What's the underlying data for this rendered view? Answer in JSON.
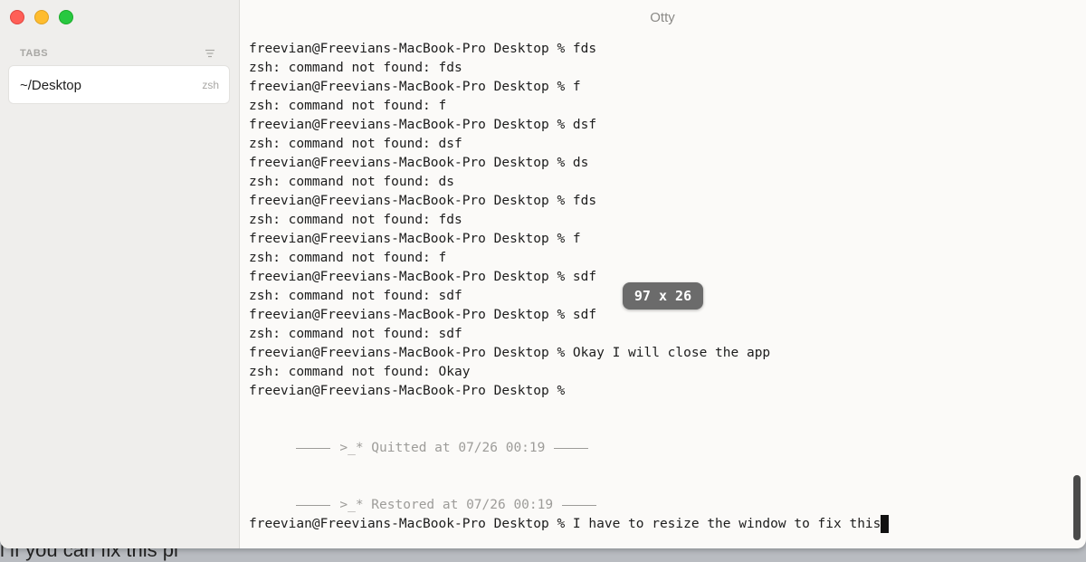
{
  "desktop_text": "l if you can fix this pl",
  "window": {
    "title": "Otty",
    "traffic_lights": {
      "close_color": "#ff5f57",
      "minimize_color": "#febc2e",
      "maximize_color": "#28c840"
    }
  },
  "sidebar": {
    "header": "TABS",
    "menu_icon": "list-lines-icon",
    "tabs": [
      {
        "title": "~/Desktop",
        "shell": "zsh"
      }
    ]
  },
  "terminal": {
    "lines": [
      "freevian@Freevians-MacBook-Pro Desktop % fds",
      "zsh: command not found: fds",
      "freevian@Freevians-MacBook-Pro Desktop % f",
      "zsh: command not found: f",
      "freevian@Freevians-MacBook-Pro Desktop % dsf",
      "zsh: command not found: dsf",
      "freevian@Freevians-MacBook-Pro Desktop % ds",
      "zsh: command not found: ds",
      "freevian@Freevians-MacBook-Pro Desktop % fds",
      "zsh: command not found: fds",
      "freevian@Freevians-MacBook-Pro Desktop % f",
      "zsh: command not found: f",
      "freevian@Freevians-MacBook-Pro Desktop % sdf",
      "zsh: command not found: sdf",
      "freevian@Freevians-MacBook-Pro Desktop % sdf",
      "zsh: command not found: sdf",
      "freevian@Freevians-MacBook-Pro Desktop % Okay I will close the app",
      "zsh: command not found: Okay",
      "freevian@Freevians-MacBook-Pro Desktop %"
    ],
    "quitted_marker": ">_* Quitted at 07/26 00:19",
    "restored_marker": ">_* Restored at 07/26 00:19",
    "current_prompt": "freevian@Freevians-MacBook-Pro Desktop % I have to resize the window to fix this"
  },
  "size_badge": "97 x 26"
}
